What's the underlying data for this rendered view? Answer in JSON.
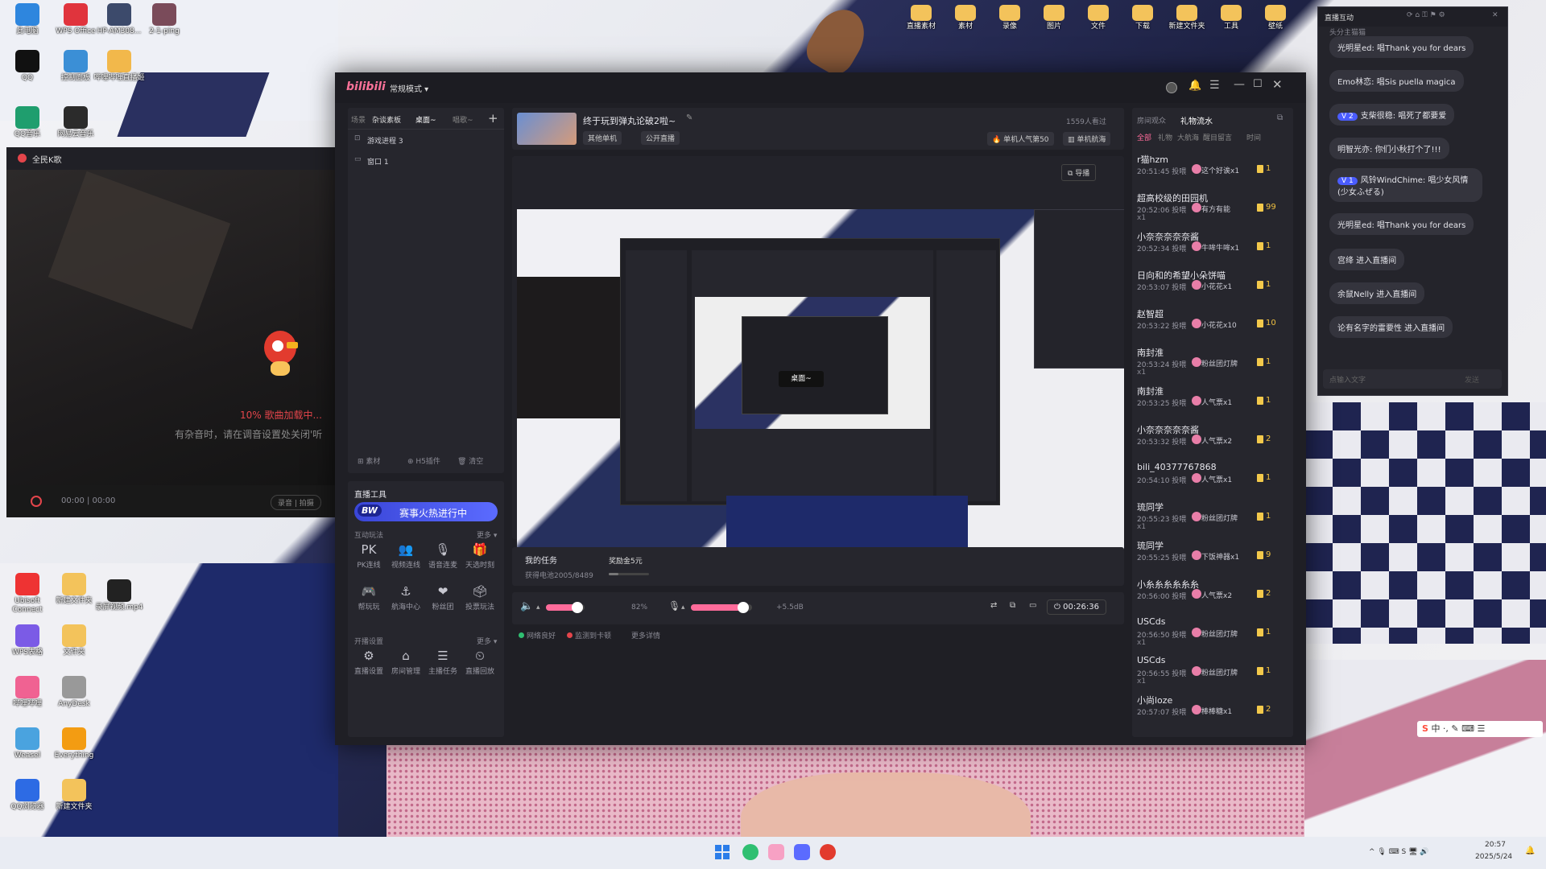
{
  "desktop": {
    "icons_left": [
      {
        "label": "此电脑",
        "color": "#2e86de"
      },
      {
        "label": "WPS Office",
        "color": "#e0343d"
      },
      {
        "label": "HP-AM308...",
        "color": "#3c4a6b"
      },
      {
        "label": "2-1-ping",
        "color": "#7a4b5a"
      },
      {
        "label": "QQ",
        "color": "#111111"
      },
      {
        "label": "控制面板",
        "color": "#3b8fd6"
      },
      {
        "label": "哔哩哔哩直播姬",
        "color": "#f2b84b"
      },
      {
        "label": "QQ音乐",
        "color": "#1f9e6e"
      },
      {
        "label": "网易云音乐",
        "color": "#2b2b2b"
      }
    ],
    "icons_lower_left": [
      {
        "label": "Ubisoft Connect",
        "color": "#e33"
      },
      {
        "label": "新建文件夹",
        "color": "#f3c35b"
      },
      {
        "label": "录屏视频.mp4",
        "color": "#222"
      },
      {
        "label": "WPS表格",
        "color": "#7b5be6"
      },
      {
        "label": "文件夹",
        "color": "#f3c35b"
      },
      {
        "label": "哔哩哔哩",
        "color": "#f06292"
      },
      {
        "label": "AnyDesk",
        "color": "#999"
      },
      {
        "label": "Weasel",
        "color": "#4aa3df"
      },
      {
        "label": "Everything",
        "color": "#f39c12"
      },
      {
        "label": "QQ浏览器",
        "color": "#2d6be4"
      },
      {
        "label": "新建文件夹",
        "color": "#f3c35b"
      }
    ],
    "icons_top_right": [
      {
        "label": "直播素材",
        "color": "#f3c35b"
      },
      {
        "label": "素材",
        "color": "#f3c35b"
      },
      {
        "label": "录像",
        "color": "#f3c35b"
      },
      {
        "label": "图片",
        "color": "#f3c35b"
      },
      {
        "label": "文件",
        "color": "#f3c35b"
      },
      {
        "label": "下载",
        "color": "#f3c35b"
      },
      {
        "label": "新建文件夹",
        "color": "#f3c35b"
      },
      {
        "label": "工具",
        "color": "#f3c35b"
      },
      {
        "label": "壁纸",
        "color": "#f3c35b"
      }
    ]
  },
  "left_panel": {
    "title": "全民K歌",
    "loading": "10% 歌曲加载中...",
    "hint": "有杂音时，请在调音设置处关闭'听",
    "time": "00:00 | 00:00",
    "record_btn": "录音 | 拍摄"
  },
  "app": {
    "logo": "bilibili",
    "mode": "常规模式",
    "scene_tabs": [
      "场景",
      "杂谈素板",
      "桌面~",
      "唱歌~"
    ],
    "sources": [
      "游戏进程 3",
      "窗口 1"
    ],
    "source_actions": [
      "素材",
      "H5插件",
      "清空"
    ],
    "tools": {
      "title": "直播工具",
      "banner_badge": "BW",
      "banner": "赛事火热进行中",
      "interactive_label": "互动玩法",
      "more": "更多",
      "interactive": [
        {
          "label": "PK连线",
          "icon": "PK"
        },
        {
          "label": "视频连线",
          "icon": "👥"
        },
        {
          "label": "语音连麦",
          "icon": "🎙"
        },
        {
          "label": "天选时刻",
          "icon": "🎁"
        },
        {
          "label": "帮玩玩",
          "icon": "🎮"
        },
        {
          "label": "航海中心",
          "icon": "⚓"
        },
        {
          "label": "粉丝团",
          "icon": "❤"
        },
        {
          "label": "投票玩法",
          "icon": "🗳"
        }
      ],
      "settings_label": "开播设置",
      "settings": [
        {
          "label": "直播设置",
          "icon": "⚙"
        },
        {
          "label": "房间管理",
          "icon": "⌂"
        },
        {
          "label": "主播任务",
          "icon": "☰"
        },
        {
          "label": "直播回放",
          "icon": "⏲"
        }
      ]
    },
    "stream": {
      "title": "终于玩到弹丸论破2啦~",
      "tags": [
        "其他单机",
        "公开直播"
      ],
      "viewers": "1559人看过",
      "rank1": "单机人气第50",
      "rank2": "单机航海",
      "director": "导播",
      "overlay_label": "桌面~"
    },
    "task": {
      "title": "我的任务",
      "reward": "奖励金5元",
      "progress": "获得电池2005/8489"
    },
    "controls": {
      "volume_pct": "82%",
      "volume_fill": 0.82,
      "mic_db": "+5.5dB",
      "mic_fill": 0.85,
      "timer": "00:26:36",
      "status": [
        "网络良好",
        "监测到卡顿",
        "更多详情"
      ]
    },
    "gift_panel": {
      "tabs": [
        "房间观众",
        "礼物流水"
      ],
      "filters": [
        "全部",
        "礼物",
        "大航海",
        "醒目留言",
        "时间"
      ],
      "rows": [
        {
          "user": "r猫hzm",
          "time": "20:51:45 投喂",
          "gift": "这个好诶x1",
          "count": "1"
        },
        {
          "user": "超高校级的田园机",
          "time": "20:52:06 投喂",
          "gift": "有方有能",
          "count": "99",
          "extra": "x1"
        },
        {
          "user": "小奈奈奈奈奈酱",
          "time": "20:52:34 投喂",
          "gift": "牛哞牛哞x1",
          "count": "1"
        },
        {
          "user": "日向和的希望小朵饼喵",
          "time": "20:53:07 投喂",
          "gift": "小花花x1",
          "count": "1"
        },
        {
          "user": "赵智超",
          "time": "20:53:22 投喂",
          "gift": "小花花x10",
          "count": "10"
        },
        {
          "user": "南封淮",
          "time": "20:53:24 投喂",
          "gift": "粉丝团灯牌",
          "count": "1",
          "extra": "x1"
        },
        {
          "user": "南封淮",
          "time": "20:53:25 投喂",
          "gift": "人气票x1",
          "count": "1"
        },
        {
          "user": "小奈奈奈奈奈酱",
          "time": "20:53:32 投喂",
          "gift": "人气票x2",
          "count": "2"
        },
        {
          "user": "bili_40377767868",
          "time": "20:54:10 投喂",
          "gift": "人气票x1",
          "count": "1"
        },
        {
          "user": "琉同学",
          "time": "20:55:23 投喂",
          "gift": "粉丝团灯牌",
          "count": "1",
          "extra": "x1"
        },
        {
          "user": "琉同学",
          "time": "20:55:25 投喂",
          "gift": "下饭神器x1",
          "count": "9"
        },
        {
          "user": "小糸糸糸糸糸糸",
          "time": "20:56:00 投喂",
          "gift": "人气票x2",
          "count": "2"
        },
        {
          "user": "USCds",
          "time": "20:56:50 投喂",
          "gift": "粉丝团灯牌",
          "count": "1",
          "extra": "x1"
        },
        {
          "user": "USCds",
          "time": "20:56:55 投喂",
          "gift": "粉丝团灯牌",
          "count": "1",
          "extra": "x1"
        },
        {
          "user": "小尚loze",
          "time": "20:57:07 投喂",
          "gift": "棒棒糖x1",
          "count": "2"
        }
      ]
    }
  },
  "chat": {
    "title": "直播互动",
    "top_partial": "头分主猫猫",
    "messages": [
      {
        "text": "光明星ed: 唱Thank you for dears",
        "level": ""
      },
      {
        "text": "Emo林恋: 唱Sis puella magica",
        "level": ""
      },
      {
        "text": "支柴很稳: 唱死了都要爱",
        "level": "2"
      },
      {
        "text": "明智光亦: 你们小秋打个了!!!",
        "level": ""
      },
      {
        "text": "风铃WindChime: 唱少女风情 (少女ふぜる)",
        "level": "1"
      },
      {
        "text": "光明星ed: 唱Thank you for dears",
        "level": ""
      },
      {
        "text": "宫绛 进入直播间",
        "level": ""
      },
      {
        "text": "余鼠Nelly 进入直播间",
        "level": ""
      },
      {
        "text": "论有名字的雷要性 进入直播间",
        "level": ""
      }
    ],
    "input_placeholder": "点输入文字",
    "send": "发送"
  },
  "taskbar": {
    "time": "20:57",
    "date": "2025/5/24",
    "ime": "中"
  },
  "colors": {
    "accent_pink": "#ff6b9a",
    "bili_blue": "#4a5cff",
    "loading_red": "#e4454b"
  }
}
